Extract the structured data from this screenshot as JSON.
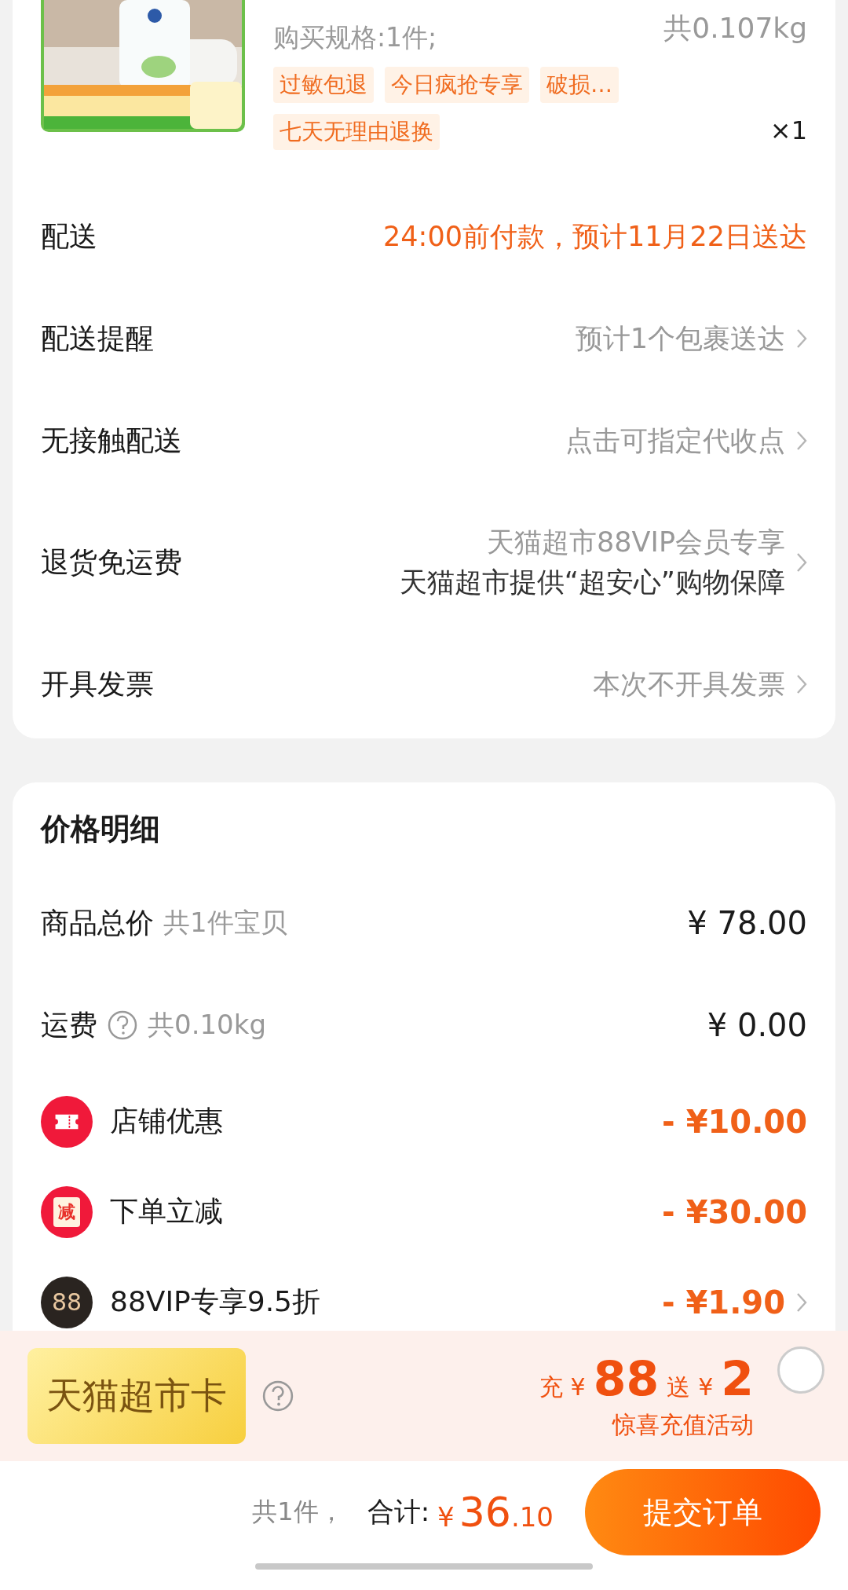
{
  "product": {
    "image": {
      "kind": "picture"
    },
    "spec": "购买规格:1件;",
    "weight": "共0.107kg",
    "tags": [
      "过敏包退",
      "今日疯抢专享",
      "破损…",
      "七天无理由退换"
    ],
    "quantity": "×1"
  },
  "order_rows": [
    {
      "label": "配送",
      "values": [
        "24:00前付款，预计11月22日送达"
      ],
      "highlight": true,
      "arrow": false
    },
    {
      "label": "配送提醒",
      "values": [
        "预计1个包裹送达"
      ],
      "highlight": false,
      "arrow": true
    },
    {
      "label": "无接触配送",
      "values": [
        "点击可指定代收点"
      ],
      "highlight": false,
      "arrow": true
    },
    {
      "label": "退货免运费",
      "values": [
        "天猫超市88VIP会员专享",
        "天猫超市提供“超安心”购物保障"
      ],
      "highlight": false,
      "arrow": true
    },
    {
      "label": "开具发票",
      "values": [
        "本次不开具发票"
      ],
      "highlight": false,
      "arrow": true
    }
  ],
  "price_detail": {
    "title": "价格明细",
    "rows": [
      {
        "kind": "plain",
        "label": "商品总价",
        "note": "共1件宝贝",
        "amount": "¥ 78.00",
        "discount": false,
        "arrow": false
      },
      {
        "kind": "help",
        "label": "运费",
        "note": "共0.10kg",
        "amount": "¥ 0.00",
        "discount": false,
        "arrow": false
      },
      {
        "kind": "ticket",
        "label": "店铺优惠",
        "amount": "- ¥10.00",
        "discount": true,
        "arrow": false,
        "color": "#f0193a"
      },
      {
        "kind": "badge",
        "badge": "减",
        "label": "下单立减",
        "amount": "- ¥30.00",
        "discount": true,
        "arrow": false,
        "color": "#f0193a"
      },
      {
        "kind": "badge",
        "badge": "88",
        "label": "88VIP专享9.5折",
        "amount": "- ¥1.90",
        "discount": true,
        "arrow": true,
        "color": "#2a2420"
      }
    ]
  },
  "card_offer": {
    "card_label": "天猫超市卡",
    "charge_prefix": "充",
    "charge_currency": "¥",
    "charge_amount": "88",
    "bonus_prefix": "送",
    "bonus_currency": "¥",
    "bonus_amount": "2",
    "subtitle": "惊喜充值活动",
    "checked": false
  },
  "checkout": {
    "count": "共1件，",
    "total_label": "合计:",
    "currency": "¥",
    "total_int": "36",
    "total_dec": ".10",
    "submit": "提交订单"
  }
}
